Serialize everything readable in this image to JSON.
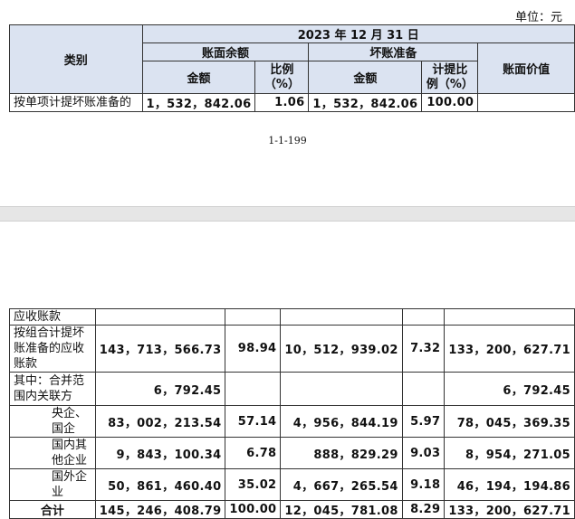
{
  "unit_label": "单位：元",
  "page_number": "1-1-199",
  "top_table": {
    "date_header": "2023 年 12 月 31 日",
    "category_header": "类别",
    "book_balance_header": "账面余额",
    "bad_debt_header": "坏账准备",
    "amount_label": "金额",
    "ratio_label_1": "比例",
    "ratio_label_2": "（%）",
    "provision_ratio_label_1": "计提比",
    "provision_ratio_label_2": "例（%）",
    "book_value_header": "账面价值",
    "row": {
      "label": "按单项计提坏账准备的",
      "amount": "1，532，842.06",
      "ratio": "1.06",
      "bad_debt": "1，532，842.06",
      "provision_ratio": "100.00",
      "book_value": ""
    }
  },
  "bottom_table": {
    "rows": [
      {
        "label": "应收账款",
        "amount": "",
        "ratio": "",
        "bad_debt": "",
        "provision_ratio": "",
        "book_value": ""
      },
      {
        "label": "按组合计提坏账准备的应收账款",
        "amount": "143，713，566.73",
        "ratio": "98.94",
        "bad_debt": "10，512，939.02",
        "provision_ratio": "7.32",
        "book_value": "133，200，627.71"
      },
      {
        "label": "其中：合并范围内关联方",
        "amount": "6，792.45",
        "ratio": "",
        "bad_debt": "",
        "provision_ratio": "",
        "book_value": "6，792.45"
      },
      {
        "label": "央企、国企",
        "amount": "83，002，213.54",
        "ratio": "57.14",
        "bad_debt": "4，956，844.19",
        "provision_ratio": "5.97",
        "book_value": "78，045，369.35"
      },
      {
        "label": "国内其他企业",
        "amount": "9，843，100.34",
        "ratio": "6.78",
        "bad_debt": "888，829.29",
        "provision_ratio": "9.03",
        "book_value": "8，954，271.05"
      },
      {
        "label": "国外企业",
        "amount": "50，861，460.40",
        "ratio": "35.02",
        "bad_debt": "4，667，265.54",
        "provision_ratio": "9.18",
        "book_value": "46，194，194.86"
      }
    ],
    "total": {
      "label": "合计",
      "amount": "145，246，408.79",
      "ratio": "100.00",
      "bad_debt": "12，045，781.08",
      "provision_ratio": "8.29",
      "book_value": "133，200，627.71"
    }
  }
}
